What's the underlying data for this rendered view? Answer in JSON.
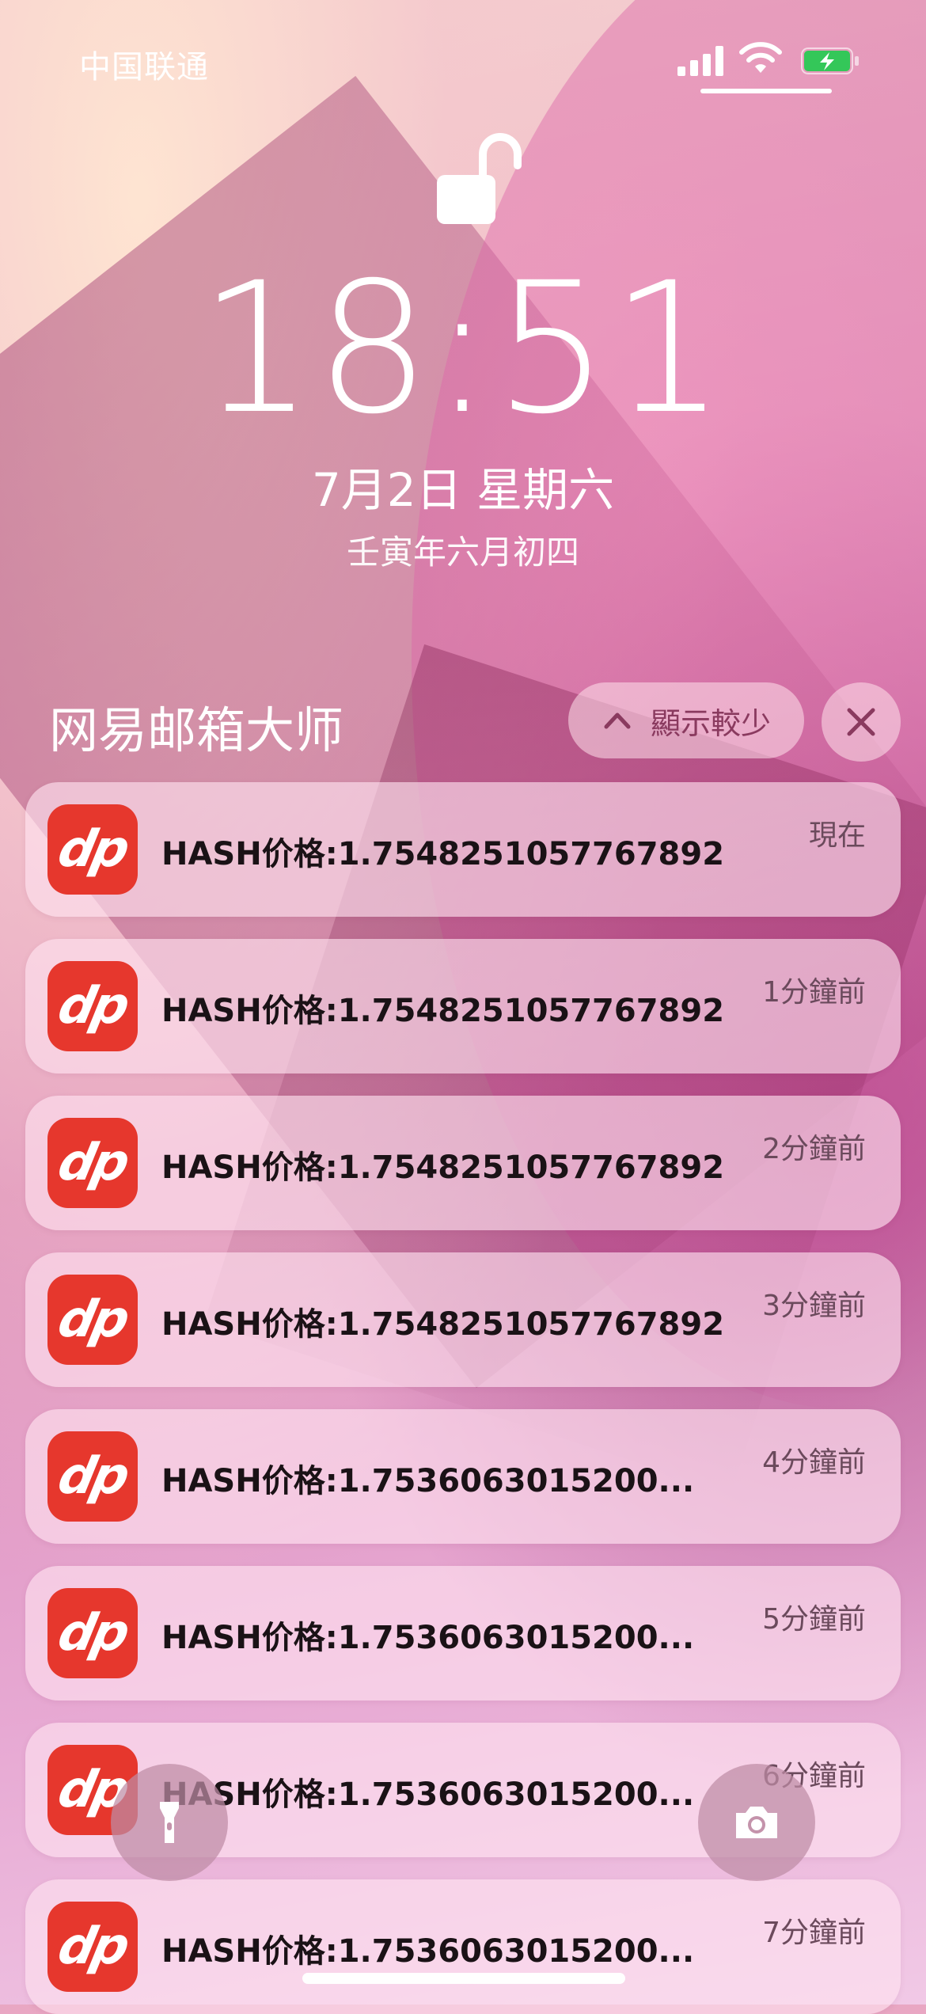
{
  "status_bar": {
    "carrier": "中国联通"
  },
  "lockscreen": {
    "time": "18:51",
    "date": "7月2日 星期六",
    "lunar_date": "壬寅年六月初四"
  },
  "notification_group": {
    "app_name": "网易邮箱大师",
    "show_less_label": "顯示較少",
    "app_icon_text": "dp",
    "notifications": [
      {
        "text": "HASH价格:1.7548251057767892",
        "time": "現在"
      },
      {
        "text": "HASH价格:1.7548251057767892",
        "time": "1分鐘前"
      },
      {
        "text": "HASH价格:1.7548251057767892",
        "time": "2分鐘前"
      },
      {
        "text": "HASH价格:1.7548251057767892",
        "time": "3分鐘前"
      },
      {
        "text": "HASH价格:1.7536063015200...",
        "time": "4分鐘前"
      },
      {
        "text": "HASH价格:1.7536063015200...",
        "time": "5分鐘前"
      },
      {
        "text": "HASH价格:1.7536063015200...",
        "time": "6分鐘前"
      },
      {
        "text": "HASH价格:1.7536063015200...",
        "time": "7分鐘前"
      }
    ]
  },
  "icons": {
    "lock": "unlocked-padlock-icon",
    "flashlight": "flashlight-icon",
    "camera": "camera-icon",
    "close": "close-icon",
    "collapse": "chevron-up-icon"
  },
  "colors": {
    "app_icon_red": "#e6372d",
    "text_white": "#ffffff"
  }
}
